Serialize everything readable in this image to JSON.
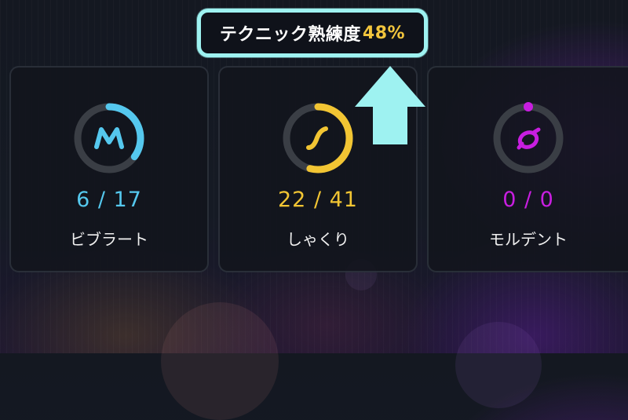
{
  "header": {
    "title": "テクニック熟練度",
    "percent": "48%"
  },
  "colors": {
    "vibrato": "#55c8ee",
    "shakuri": "#f2c533",
    "mordent": "#c81ee0",
    "track": "#3a3e45",
    "highlight": "#9ef2f1"
  },
  "cards": [
    {
      "id": "vibrato",
      "icon": "vibrato-icon",
      "glyph": "M",
      "count": "6 / 17",
      "progress": 0.35,
      "label": "ビブラート"
    },
    {
      "id": "shakuri",
      "icon": "shakuri-icon",
      "glyph": "S",
      "count": "22 /  41",
      "progress": 0.54,
      "label": "しゃくり"
    },
    {
      "id": "mordent",
      "icon": "mordent-icon",
      "glyph": "o",
      "count": "0 /  0",
      "progress": 0,
      "label": "モルデント"
    }
  ],
  "annotation": {
    "icon": "up-arrow-icon"
  }
}
